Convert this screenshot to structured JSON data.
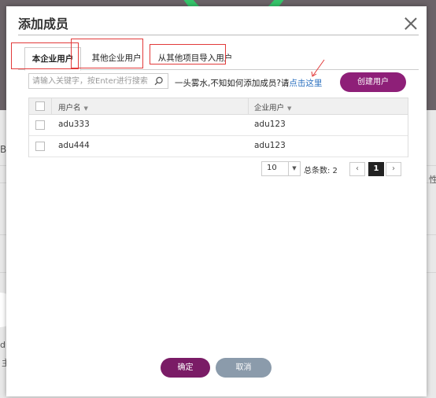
{
  "dialog": {
    "title": "添加成员"
  },
  "tabs": [
    {
      "label": "本企业用户",
      "active": true
    },
    {
      "label": "其他企业用户",
      "active": false
    },
    {
      "label": "从其他项目导入用户",
      "active": false
    }
  ],
  "search": {
    "placeholder": "请输入关键字，按Enter进行搜索",
    "value": ""
  },
  "help": {
    "text": "一头雾水,不知如何添加成员?请",
    "link": "点击这里"
  },
  "create_button": "创建用户",
  "table": {
    "columns": [
      "用户名",
      "企业用户"
    ],
    "rows": [
      {
        "username": "adu333",
        "enterprise": "adu123",
        "checked": false
      },
      {
        "username": "adu444",
        "enterprise": "adu123",
        "checked": false
      }
    ]
  },
  "pagination": {
    "page_size": "10",
    "total_label": "总条数: 2",
    "current_page": "1",
    "prev": "‹",
    "next": "›"
  },
  "footer": {
    "ok": "确定",
    "cancel": "取消"
  },
  "background": {
    "left_text_1": "Bu",
    "left_text_2": "du",
    "left_text_3": "主",
    "right_text": "性"
  },
  "colors": {
    "primary": "#8e1f78",
    "ok": "#7a1c66",
    "cancel": "#8b9bab",
    "link": "#2a6fbf",
    "annotation": "#e23a3a"
  }
}
